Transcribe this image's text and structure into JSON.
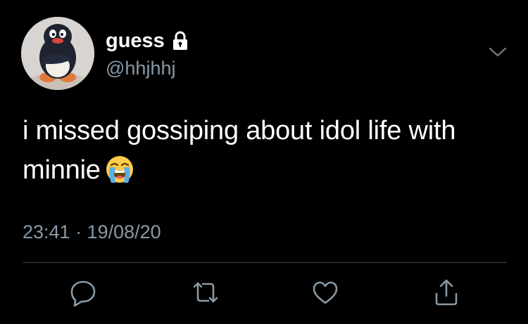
{
  "tweet": {
    "author": {
      "display_name": "guess",
      "handle": "@hhjhhj",
      "protected_icon": "lock-icon",
      "avatar_icon": "penguin-avatar"
    },
    "text_lines": [
      "i missed gossiping about idol life with",
      "minnie"
    ],
    "emoji": "loudly-crying-face-emoji",
    "timestamp": "23:41 · 19/08/20",
    "menu_icon": "chevron-down-icon"
  },
  "actions": [
    {
      "icon": "reply-icon"
    },
    {
      "icon": "retweet-icon"
    },
    {
      "icon": "like-icon"
    },
    {
      "icon": "share-icon"
    }
  ],
  "colors": {
    "background": "#000000",
    "primary_text": "#ffffff",
    "secondary_text": "#8899a6",
    "divider": "#38444d"
  }
}
